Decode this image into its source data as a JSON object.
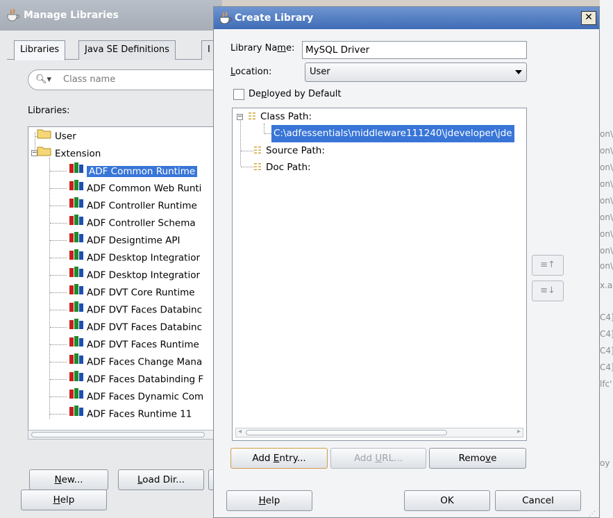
{
  "manage_libraries": {
    "title": "Manage Libraries",
    "tabs": [
      "Libraries",
      "Java SE Definitions",
      "I"
    ],
    "search_placeholder": "Class name",
    "libraries_label": "Libraries:",
    "tree": [
      {
        "label": "User",
        "type": "folder"
      },
      {
        "label": "Extension",
        "type": "folder-open"
      },
      {
        "label": "ADF Common Runtime",
        "type": "library",
        "selected": true
      },
      {
        "label": "ADF Common Web Runti",
        "type": "library"
      },
      {
        "label": "ADF Controller Runtime",
        "type": "library"
      },
      {
        "label": "ADF Controller Schema",
        "type": "library"
      },
      {
        "label": "ADF Designtime API",
        "type": "library"
      },
      {
        "label": "ADF Desktop Integratior",
        "type": "library"
      },
      {
        "label": "ADF Desktop Integratior",
        "type": "library"
      },
      {
        "label": "ADF DVT Core Runtime",
        "type": "library"
      },
      {
        "label": "ADF DVT Faces Databinc",
        "type": "library"
      },
      {
        "label": "ADF DVT Faces Databinc",
        "type": "library"
      },
      {
        "label": "ADF DVT Faces Runtime",
        "type": "library"
      },
      {
        "label": "ADF Faces Change Mana",
        "type": "library"
      },
      {
        "label": "ADF Faces Databinding F",
        "type": "library"
      },
      {
        "label": "ADF Faces Dynamic Com",
        "type": "library"
      },
      {
        "label": "ADF Faces Runtime 11",
        "type": "library"
      }
    ],
    "buttons": {
      "new": "New...",
      "load_dir": "Load Dir...",
      "help": "Help"
    }
  },
  "create_library": {
    "title": "Create Library",
    "library_name_label": "Library Name:",
    "library_name_value": "MySQL Driver",
    "location_label": "Location:",
    "location_value": "User",
    "deployed_label": "Deployed by Default",
    "paths": {
      "class_path": "Class Path:",
      "class_path_entry": "C:\\adfessentials\\middleware111240\\jdeveloper\\jde",
      "source_path": "Source Path:",
      "doc_path": "Doc Path:"
    },
    "buttons": {
      "add_entry": "Add Entry...",
      "add_url": "Add URL...",
      "remove": "Remove",
      "help": "Help",
      "ok": "OK",
      "cancel": "Cancel",
      "move_up": "↑",
      "move_down": "↓"
    }
  },
  "background_right": {
    "lines": [
      "on\\",
      "on\\",
      "on\\",
      "on\\",
      "on\\",
      "on\\",
      "on\\",
      "on\\",
      "on\\",
      "x.a",
      "C4]",
      "C4]",
      "C4]",
      "C4]",
      "lfc'",
      "oy"
    ]
  },
  "colors": {
    "selection": "#3875d7",
    "title_active": "#3f6cb6",
    "title_inactive": "#a7adb7"
  }
}
